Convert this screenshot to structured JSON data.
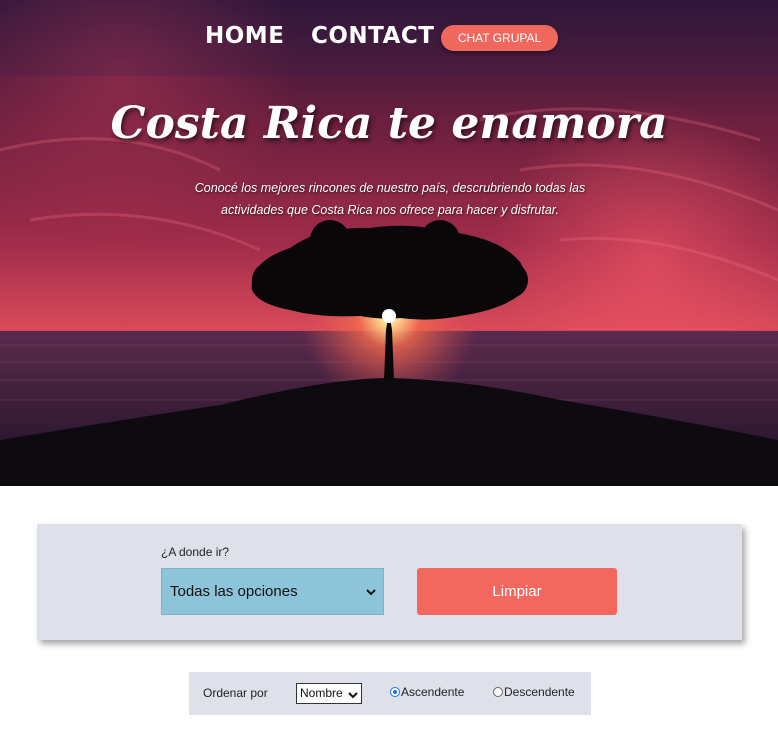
{
  "nav": {
    "home_label": "HOME",
    "contact_label": "CONTACT",
    "chat_label": "CHAT GRUPAL"
  },
  "hero": {
    "title": "Costa Rica te enamora",
    "subtitle": "Conocé los mejores rincones de nuestro país, descrubriendo todas las actividades que Costa Rica nos ofrece para hacer y disfrutar."
  },
  "filter": {
    "label": "¿A donde ir?",
    "select_value": "Todas las opciones",
    "clear_label": "Limpiar"
  },
  "sort": {
    "label": "Ordenar por",
    "select_value": "Nombre",
    "asc_label": "Ascendente",
    "desc_label": "Descendente",
    "selected": "Ascendente"
  },
  "colors": {
    "accent": "#f0685d",
    "select_bg": "#8ec4d9",
    "panel_bg": "#dfe1ea"
  }
}
